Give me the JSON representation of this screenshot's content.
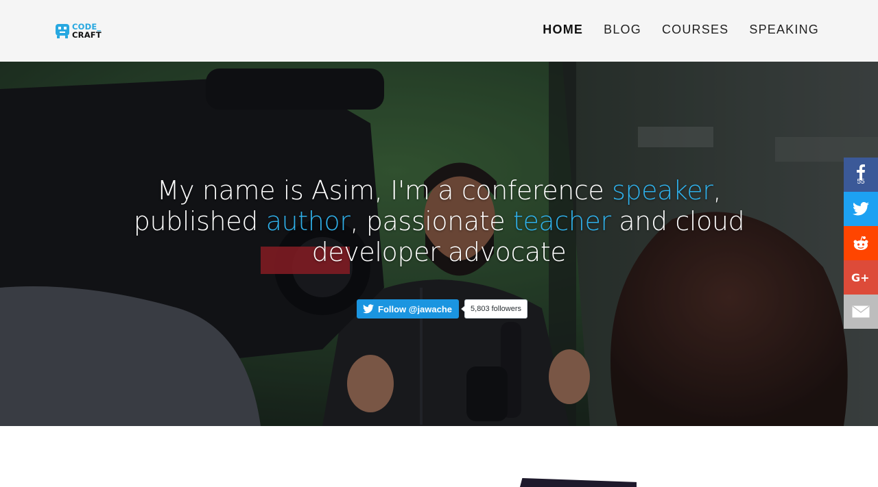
{
  "logo": {
    "line1": "CODE_",
    "line2": "CRAFT",
    "icon": "code-craft-logo-icon"
  },
  "nav": [
    {
      "label": "HOME",
      "active": true
    },
    {
      "label": "BLOG",
      "active": false
    },
    {
      "label": "COURSES",
      "active": false
    },
    {
      "label": "SPEAKING",
      "active": false
    }
  ],
  "hero": {
    "headline_parts": [
      {
        "text": "My name is Asim, I'm a conference ",
        "highlight": false
      },
      {
        "text": "speaker",
        "highlight": true
      },
      {
        "text": ", published ",
        "highlight": false
      },
      {
        "text": "author",
        "highlight": true
      },
      {
        "text": ", passionate ",
        "highlight": false
      },
      {
        "text": "teacher",
        "highlight": true
      },
      {
        "text": " and cloud developer advocate",
        "highlight": false
      }
    ],
    "follow_label": "Follow @jawache",
    "followers": "5,803 followers"
  },
  "share": {
    "facebook_count": "55",
    "icons": [
      "facebook-icon",
      "twitter-icon",
      "reddit-icon",
      "google-plus-icon",
      "email-icon"
    ]
  },
  "colors": {
    "accent": "#2fb0ea",
    "header_bg": "#f5f5f5",
    "twitter_button": "#1b95e0",
    "facebook": "#3b5998",
    "twitter": "#1da1f2",
    "reddit": "#ff4500",
    "google_plus": "#dd4b39",
    "email": "#bdbdbd"
  }
}
